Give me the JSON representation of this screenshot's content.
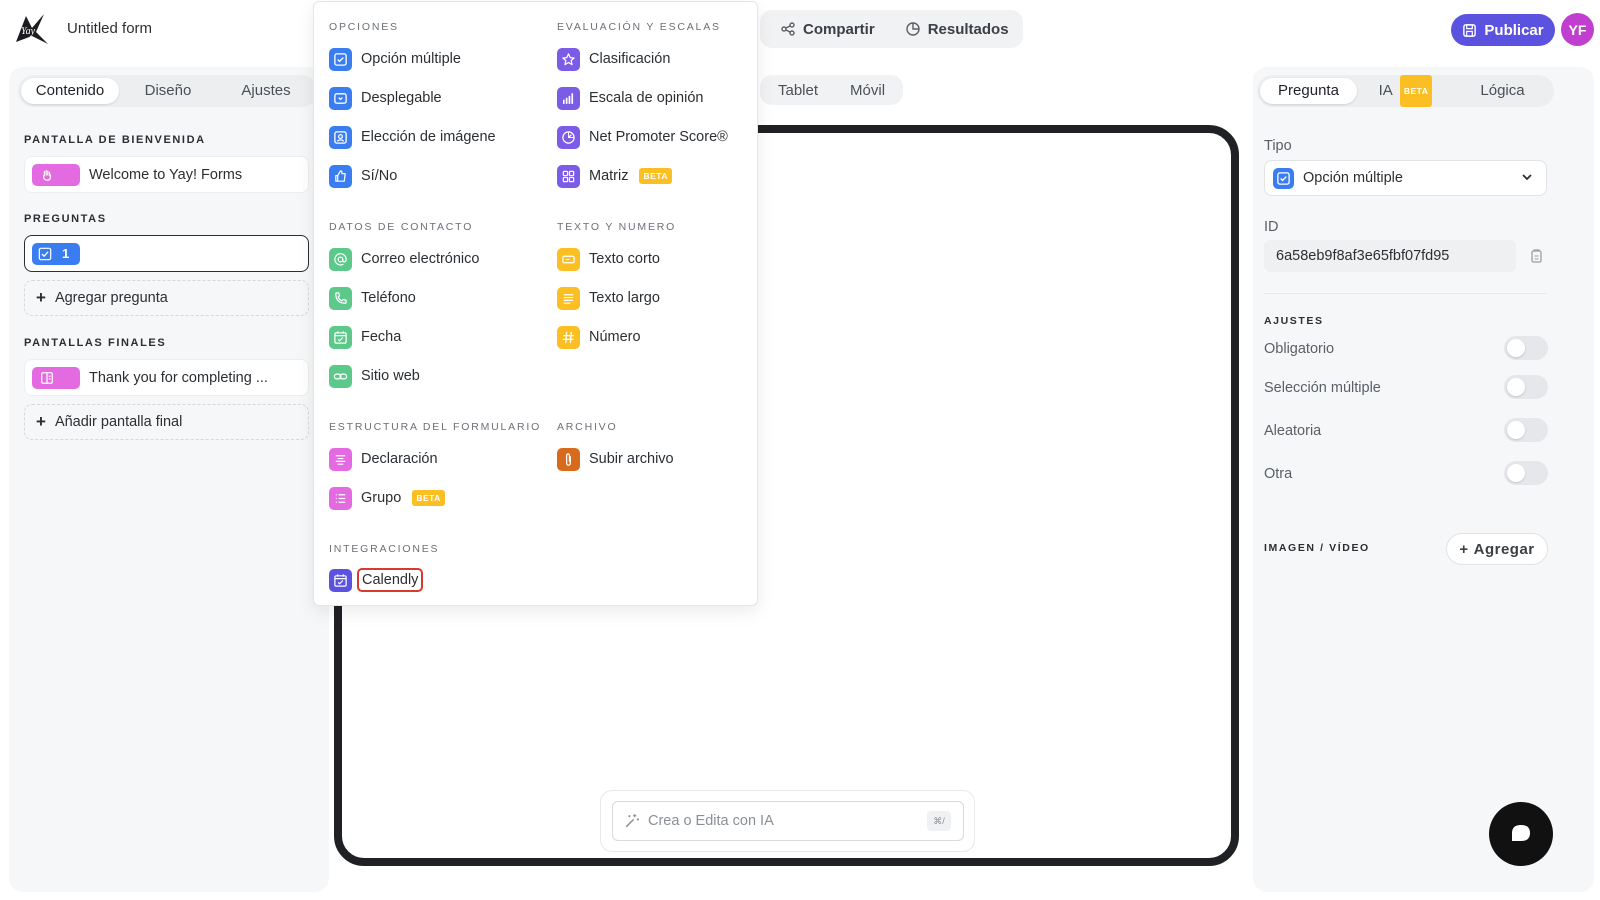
{
  "header": {
    "form_title": "Untitled form",
    "share_label": "Compartir",
    "results_label": "Resultados",
    "publish_label": "Publicar",
    "avatar_initials": "YF"
  },
  "left": {
    "tabs": [
      "Contenido",
      "Diseño",
      "Ajustes"
    ],
    "welcome_title": "PANTALLA DE BIENVENIDA",
    "welcome_card": "Welcome to Yay! Forms",
    "questions_title": "PREGUNTAS",
    "question_number": "1",
    "add_question": "Agregar pregunta",
    "endings_title": "PANTALLAS FINALES",
    "ending_card": "Thank you for completing ...",
    "add_ending": "Añadir pantalla final"
  },
  "center": {
    "device_tabs": [
      "Tablet",
      "Móvil"
    ],
    "ai_placeholder": "Crea o Edita con IA",
    "ai_shortcut": "⌘/"
  },
  "dropdown": {
    "opciones_title": "OPCIONES",
    "opciones": [
      "Opción múltiple",
      "Desplegable",
      "Elección de imágene",
      "Sí/No"
    ],
    "evaluacion_title": "EVALUACIÓN Y ESCALAS",
    "evaluacion": [
      "Clasificación",
      "Escala de opinión",
      "Net Promoter Score®",
      "Matriz"
    ],
    "contacto_title": "DATOS DE CONTACTO",
    "contacto": [
      "Correo electrónico",
      "Teléfono",
      "Fecha",
      "Sitio web"
    ],
    "texto_title": "TEXTO Y NUMERO",
    "texto": [
      "Texto corto",
      "Texto largo",
      "Número"
    ],
    "estructura_title": "ESTRUCTURA DEL FORMULARIO",
    "estructura": [
      "Declaración",
      "Grupo"
    ],
    "archivo_title": "ARCHIVO",
    "archivo": [
      "Subir archivo"
    ],
    "integraciones_title": "INTEGRACIONES",
    "integraciones": [
      "Calendly"
    ],
    "beta_badge": "BETA"
  },
  "right": {
    "tabs": [
      "Pregunta",
      "IA",
      "Lógica"
    ],
    "ia_badge": "BETA",
    "tipo_label": "Tipo",
    "tipo_value": "Opción múltiple",
    "id_label": "ID",
    "id_value": "6a58eb9f8af3e65fbf07fd95",
    "ajustes_title": "AJUSTES",
    "settings": [
      "Obligatorio",
      "Selección múltiple",
      "Aleatoria",
      "Otra"
    ],
    "media_title": "IMAGEN / VÍDEO",
    "add_media": "Agregar"
  },
  "colors": {
    "blue": "#3a7df0",
    "purple": "#7b5ce6",
    "green": "#5cc98a",
    "yellow": "#fbbf24",
    "pink": "#e46ae2",
    "orange": "#d86a1e",
    "indigo": "#5b53e0",
    "highlight": "#d63b2d"
  }
}
